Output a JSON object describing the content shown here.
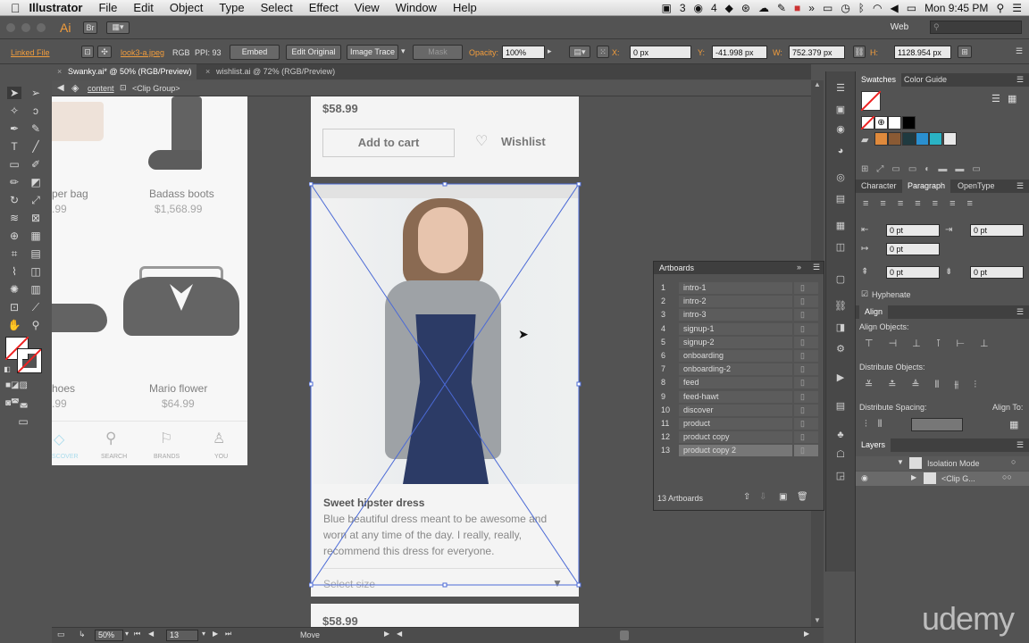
{
  "menubar": {
    "apple": "",
    "app": "Illustrator",
    "items": [
      "File",
      "Edit",
      "Object",
      "Type",
      "Select",
      "Effect",
      "View",
      "Window",
      "Help"
    ],
    "status": {
      "ai_badge": "3",
      "ball_badge": "4",
      "clock": "Mon 9:45 PM"
    }
  },
  "appbar": {
    "ai_logo": "Ai",
    "br_logo": "Br",
    "workspace": "Web"
  },
  "control": {
    "linked_file": "Linked File",
    "filename": "look3-a.jpeg",
    "color_mode": "RGB",
    "ppi": "PPI: 93",
    "embed": "Embed",
    "edit_original": "Edit Original",
    "image_trace": "Image Trace",
    "mask": "Mask",
    "opacity_label": "Opacity:",
    "opacity": "100%",
    "x_label": "X:",
    "x": "0 px",
    "y_label": "Y:",
    "y": "-41.998 px",
    "w_label": "W:",
    "w": "752.379 px",
    "h_label": "H:",
    "h": "1128.954 px"
  },
  "tabs": [
    {
      "label": "Swanky.ai* @ 50% (RGB/Preview)"
    },
    {
      "label": "wishlist.ai @ 72% (RGB/Preview)"
    }
  ],
  "breadcrumbs": {
    "layer": "content",
    "group": "<Clip Group>"
  },
  "artboard_left": {
    "item1_name": "per bag",
    "item1_price": ".99",
    "item2_name": "Badass boots",
    "item2_price": "$1,568.99",
    "item3_name": "hoes",
    "item3_price": ".99",
    "item4_name": "Mario flower",
    "item4_price": "$64.99",
    "nav": [
      "SCOVER",
      "SEARCH",
      "BRANDS",
      "YOU"
    ]
  },
  "artboard_top": {
    "price": "$58.99",
    "add_to_cart": "Add to cart",
    "wishlist": "Wishlist"
  },
  "artboard_main": {
    "title": "Sweet hipster dress",
    "desc1": "Blue beautiful dress meant to be awesome and",
    "desc2": "worn at any time of the day. I really, really,",
    "desc3": "recommend this dress for everyone.",
    "select_size": "Select size",
    "price_bottom": "$58.99"
  },
  "panels": {
    "swatches": "Swatches",
    "color_guide": "Color Guide",
    "character": "Character",
    "paragraph": "Paragraph",
    "opentype": "OpenType",
    "para_vals": [
      "0 pt",
      "0 pt",
      "0 pt",
      "0 pt",
      "0 pt"
    ],
    "hyphenate": "Hyphenate",
    "align": "Align",
    "align_objects": "Align Objects:",
    "distribute_objects": "Distribute Objects:",
    "distribute_spacing": "Distribute Spacing:",
    "align_to": "Align To:",
    "layers": "Layers",
    "isolation_mode": "Isolation Mode",
    "clip_group": "<Clip G..."
  },
  "artboards_panel": {
    "title": "Artboards",
    "count": "13 Artboards",
    "rows": [
      {
        "n": "1",
        "name": "intro-1"
      },
      {
        "n": "2",
        "name": "intro-2"
      },
      {
        "n": "3",
        "name": "intro-3"
      },
      {
        "n": "4",
        "name": "signup-1"
      },
      {
        "n": "5",
        "name": "signup-2"
      },
      {
        "n": "6",
        "name": "onboarding"
      },
      {
        "n": "7",
        "name": "onboarding-2"
      },
      {
        "n": "8",
        "name": "feed"
      },
      {
        "n": "9",
        "name": "feed-hawt"
      },
      {
        "n": "10",
        "name": "discover"
      },
      {
        "n": "11",
        "name": "product"
      },
      {
        "n": "12",
        "name": "product copy"
      },
      {
        "n": "13",
        "name": "product copy 2"
      }
    ]
  },
  "bottom": {
    "zoom": "50%",
    "artboard_num": "13",
    "tool_state": "Move"
  },
  "watermark": "udemy"
}
